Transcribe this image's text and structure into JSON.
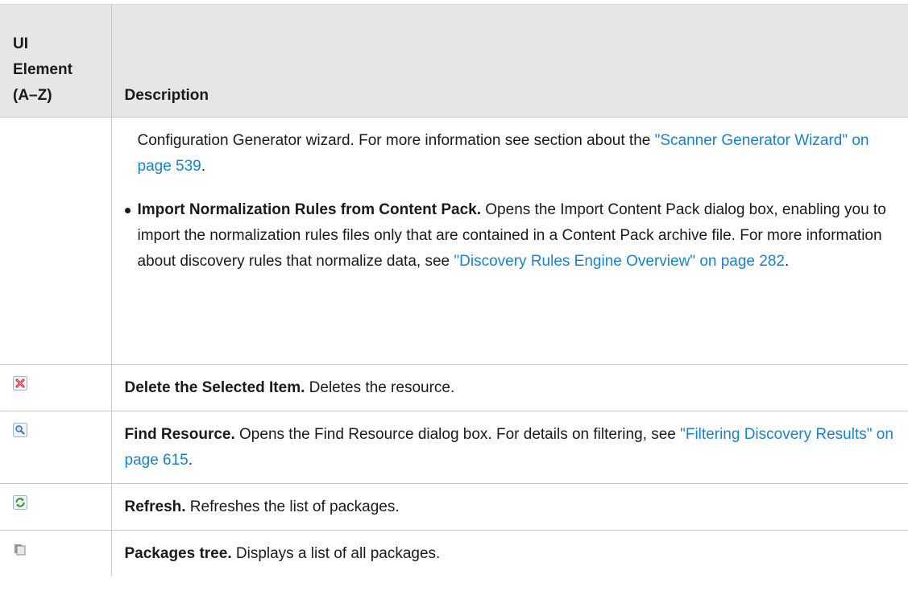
{
  "table": {
    "header": {
      "col1_line1": "UI",
      "col1_line2": "Element",
      "col1_line3": "(A–Z)",
      "col2": "Description"
    },
    "continuation_row": {
      "text_start": "Configuration Generator wizard. For more information see section about the ",
      "link1": "\"Scanner Generator Wizard\" on page 539",
      "text_end": ".",
      "bullet": {
        "bold": "Import Normalization Rules from Content Pack.",
        "text": " Opens the Import Content Pack dialog box, enabling you to import the normalization rules files only that are contained in a Content Pack archive file. For more information about discovery rules that normalize data, see ",
        "link": "\"Discovery Rules Engine Overview\" on page 282",
        "text_end": "."
      }
    },
    "rows": [
      {
        "icon": "delete-icon",
        "bold": "Delete the Selected Item.",
        "text": " Deletes the resource."
      },
      {
        "icon": "find-resource-icon",
        "bold": "Find Resource.",
        "text": " Opens the Find Resource dialog box. For details on filtering, see ",
        "link": "\"Filtering Discovery Results\" on page 615",
        "text_end": "."
      },
      {
        "icon": "refresh-icon",
        "bold": "Refresh.",
        "text": " Refreshes the list of packages."
      },
      {
        "icon": "packages-tree-icon",
        "bold": "Packages tree.",
        "text": " Displays a list of all packages."
      }
    ]
  },
  "colors": {
    "header_bg": "#e6e6e6",
    "link": "#1a82c8",
    "border": "#c8c8c8"
  }
}
